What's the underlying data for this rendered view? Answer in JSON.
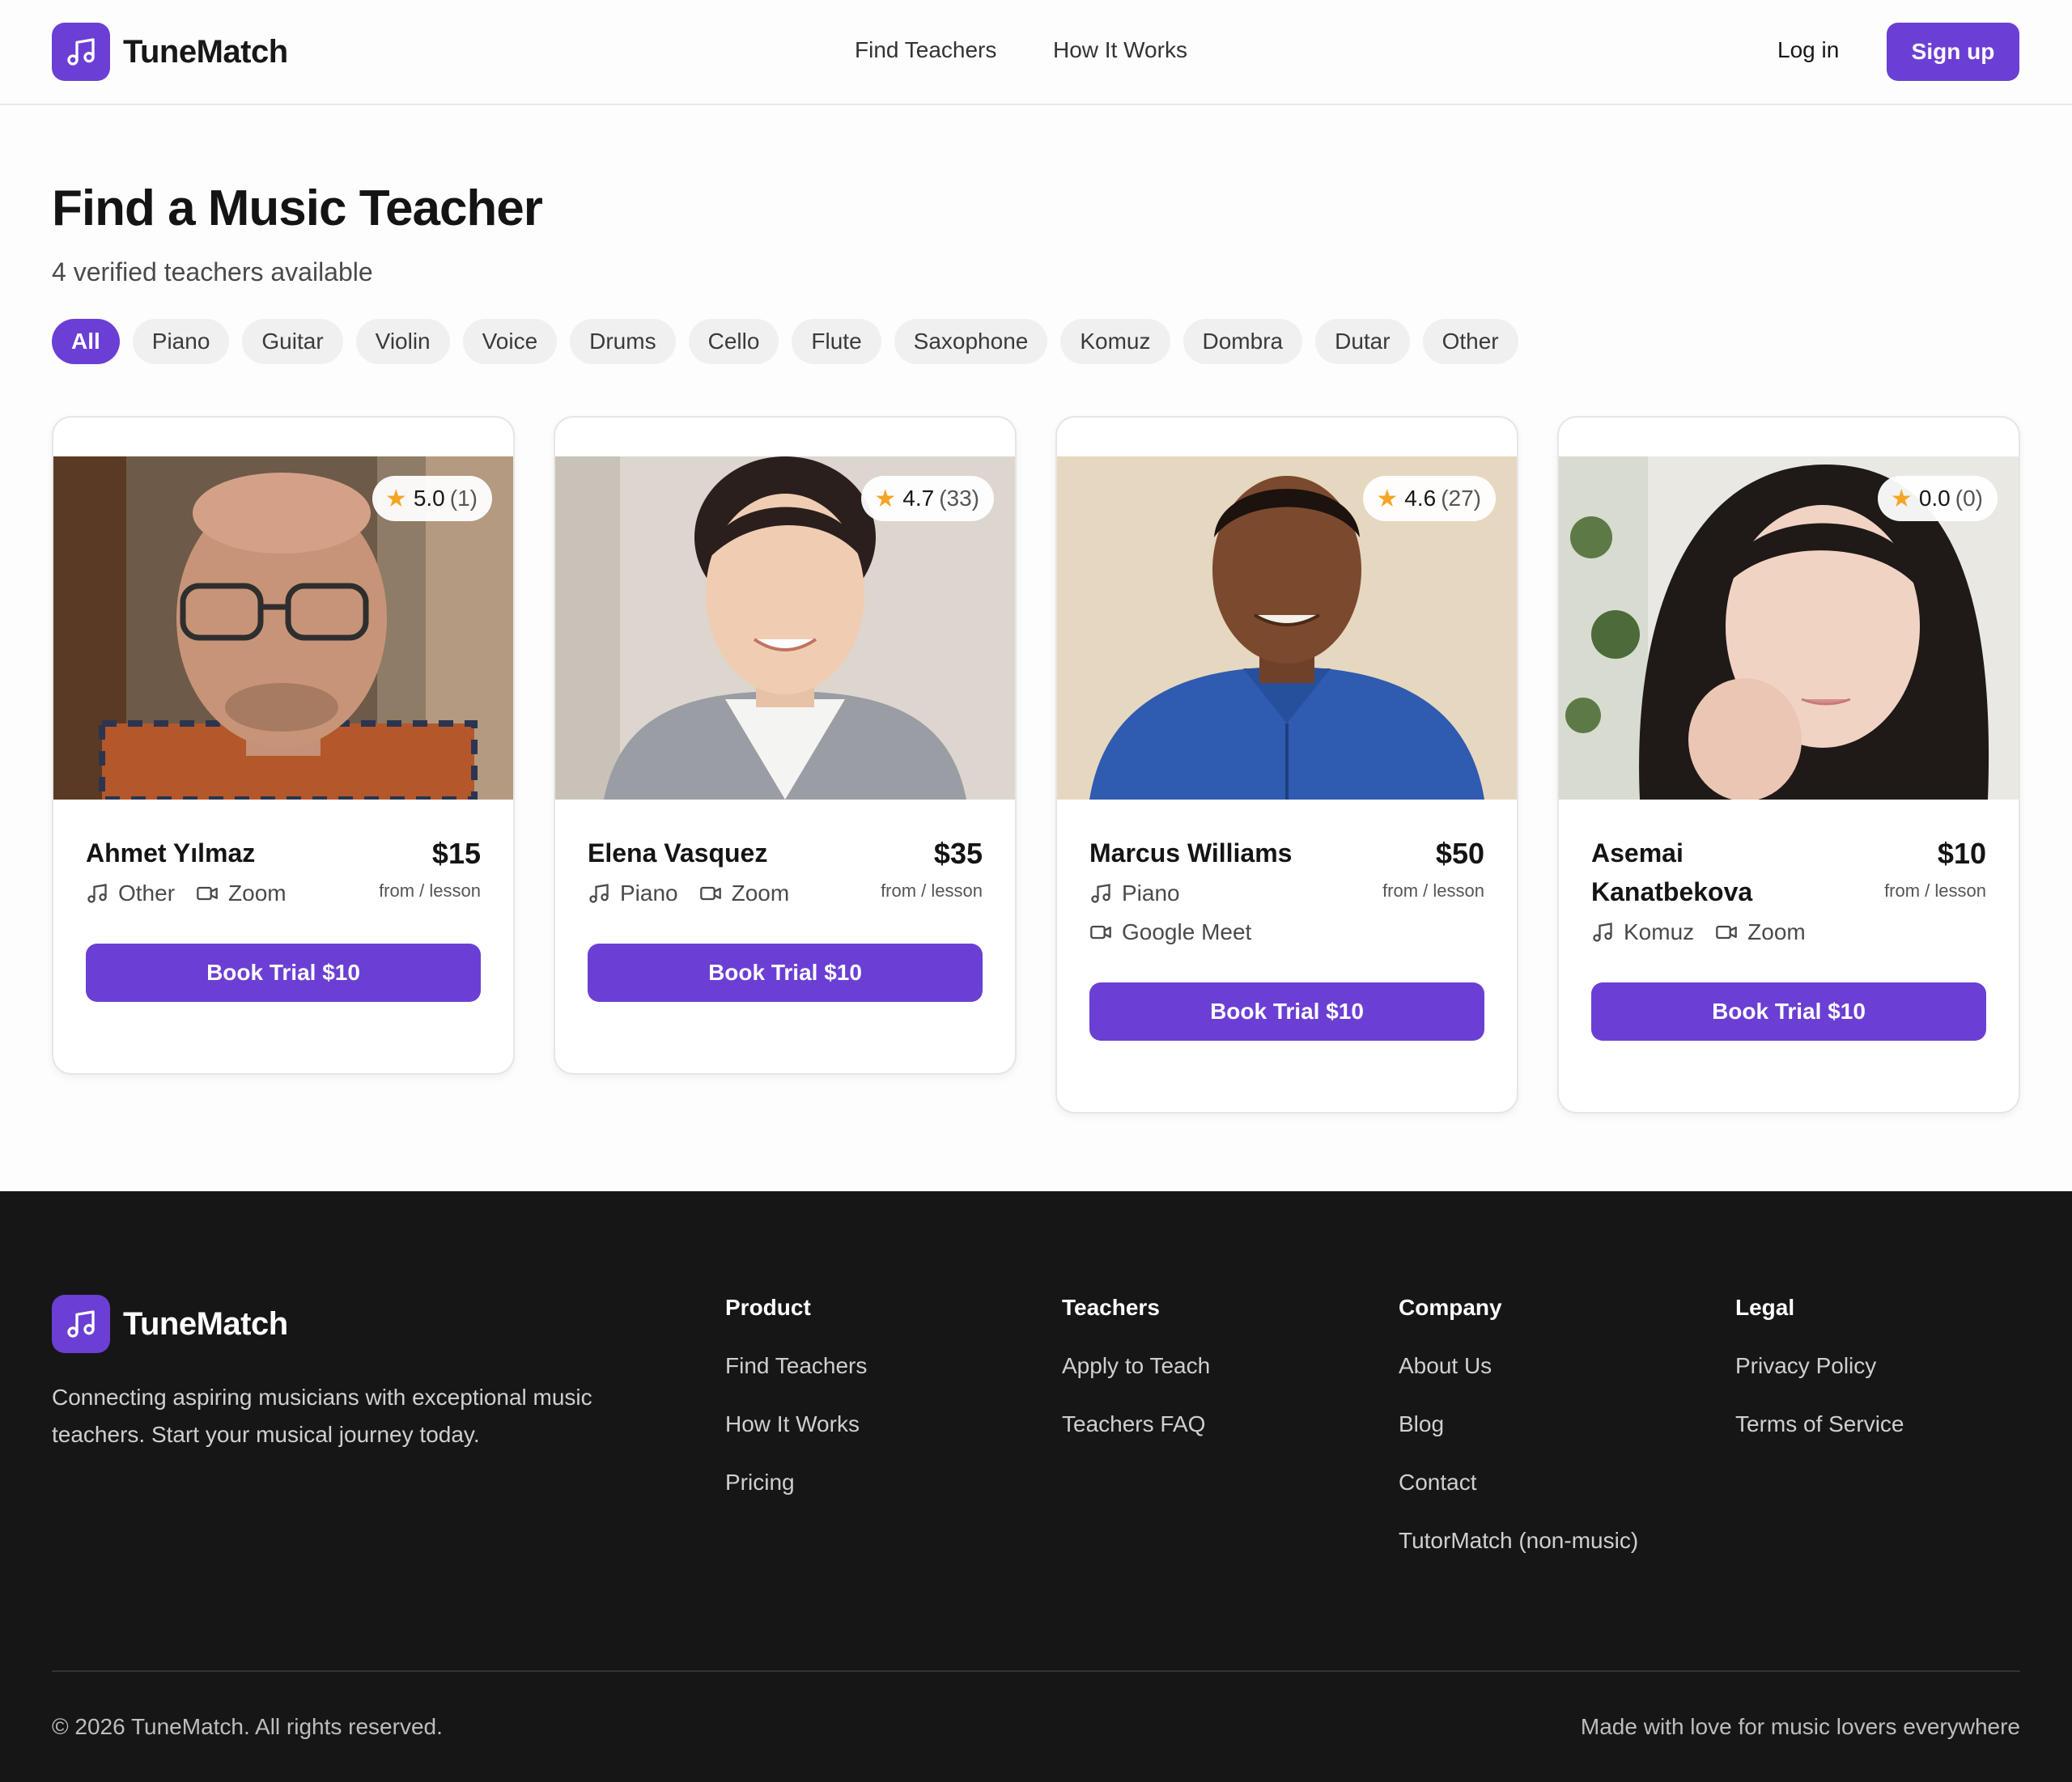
{
  "brand": {
    "name": "TuneMatch",
    "logo_icon": "music-note-icon",
    "accent": "#6b3fd4"
  },
  "nav": {
    "find_teachers": "Find Teachers",
    "how_it_works": "How It Works",
    "login": "Log in",
    "signup": "Sign up"
  },
  "page": {
    "title": "Find a Music Teacher",
    "subtitle": "4 verified teachers available"
  },
  "filters": [
    "All",
    "Piano",
    "Guitar",
    "Violin",
    "Voice",
    "Drums",
    "Cello",
    "Flute",
    "Saxophone",
    "Komuz",
    "Dombra",
    "Dutar",
    "Other"
  ],
  "active_filter": "All",
  "teachers": [
    {
      "name": "Ahmet Yılmaz",
      "price": "$15",
      "unit": "from / lesson",
      "rating": "5.0",
      "reviews": "(1)",
      "instrument": "Other",
      "platform": "Zoom",
      "book": "Book Trial $10"
    },
    {
      "name": "Elena Vasquez",
      "price": "$35",
      "unit": "from / lesson",
      "rating": "4.7",
      "reviews": "(33)",
      "instrument": "Piano",
      "platform": "Zoom",
      "book": "Book Trial $10"
    },
    {
      "name": "Marcus Williams",
      "price": "$50",
      "unit": "from / lesson",
      "rating": "4.6",
      "reviews": "(27)",
      "instrument": "Piano",
      "platform": "Google Meet",
      "book": "Book Trial $10"
    },
    {
      "name": "Asemai Kanatbekova",
      "price": "$10",
      "unit": "from / lesson",
      "rating": "0.0",
      "reviews": "(0)",
      "instrument": "Komuz",
      "platform": "Zoom",
      "book": "Book Trial $10"
    }
  ],
  "footer": {
    "tagline": "Connecting aspiring musicians with exceptional music teachers. Start your musical journey today.",
    "product": {
      "title": "Product",
      "links": [
        "Find Teachers",
        "How It Works",
        "Pricing"
      ]
    },
    "teachers": {
      "title": "Teachers",
      "links": [
        "Apply to Teach",
        "Teachers FAQ"
      ]
    },
    "company": {
      "title": "Company",
      "links": [
        "About Us",
        "Blog",
        "Contact",
        "TutorMatch (non-music)"
      ]
    },
    "legal": {
      "title": "Legal",
      "links": [
        "Privacy Policy",
        "Terms of Service"
      ]
    },
    "copyright": "© 2026 TuneMatch. All rights reserved.",
    "love": "Made with love for music lovers everywhere"
  }
}
